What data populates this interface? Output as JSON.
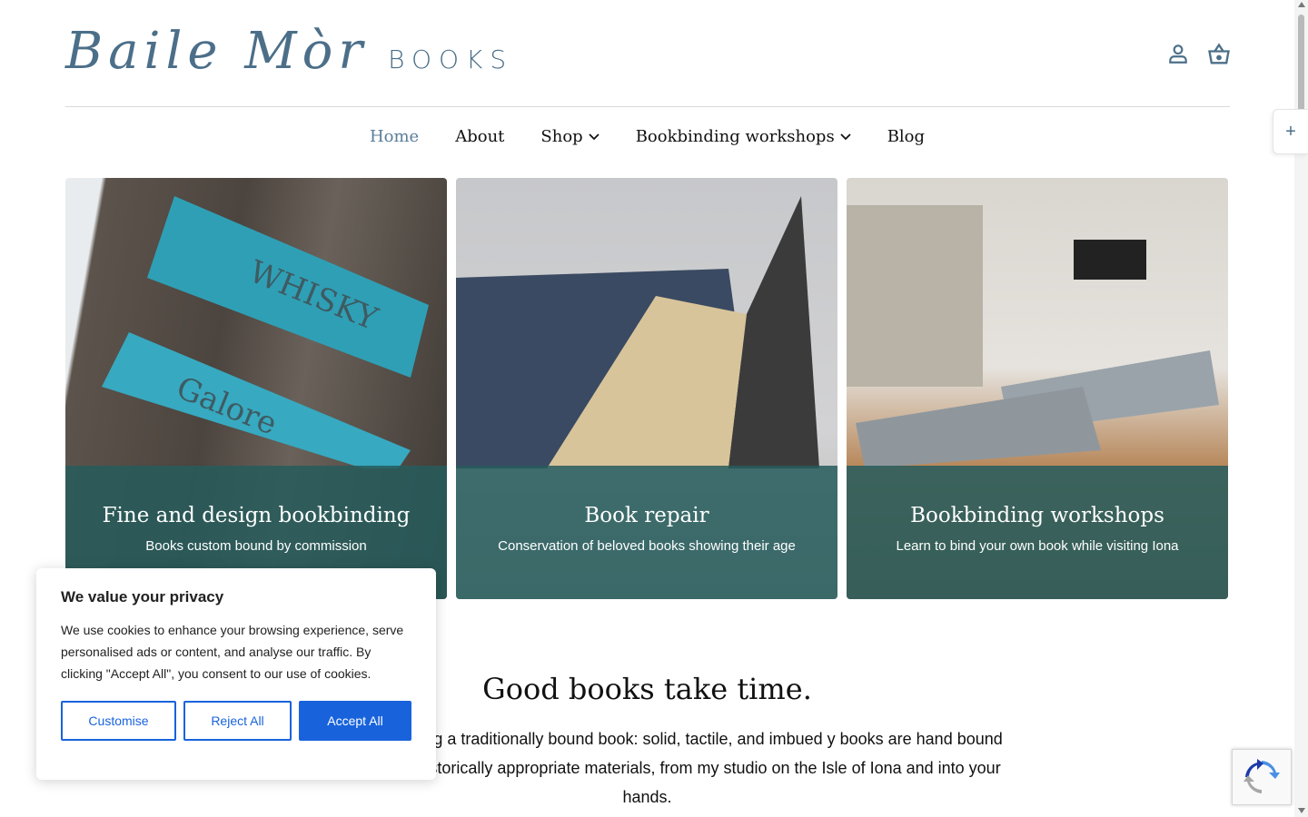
{
  "brand": {
    "script": "Baile Mòr",
    "word": "BOOKS",
    "color": "#4c6f89"
  },
  "header_icons": [
    "account-icon",
    "basket-icon"
  ],
  "nav": [
    {
      "label": "Home",
      "active": true
    },
    {
      "label": "About"
    },
    {
      "label": "Shop",
      "dropdown": true
    },
    {
      "label": "Bookbinding workshops",
      "dropdown": true
    },
    {
      "label": "Blog"
    }
  ],
  "side_tab": "+",
  "cards": [
    {
      "title": "Fine and design bookbinding",
      "subtitle": "Books custom bound by commission",
      "image_text_1": "WHISKY",
      "image_text_2": "Galore"
    },
    {
      "title": "Book repair",
      "subtitle": "Conservation of beloved books showing their age"
    },
    {
      "title": "Bookbinding workshops",
      "subtitle": "Learn to bind your own book while visiting Iona"
    }
  ],
  "main": {
    "heading": "Good books take time.",
    "paragraph": "the feeling of holding a traditionally bound book: solid, tactile, and imbued y books are hand bound using modern or historically appropriate materials, from my studio on the Isle of Iona and into your hands."
  },
  "cookie": {
    "title": "We value your privacy",
    "body": "We use cookies to enhance your browsing experience, serve personalised ads or content, and analyse our traffic. By clicking \"Accept All\", you consent to our use of cookies.",
    "customise": "Customise",
    "reject": "Reject All",
    "accept": "Accept All",
    "accent": "#1863dc"
  },
  "overlay_color": "#265c5c"
}
